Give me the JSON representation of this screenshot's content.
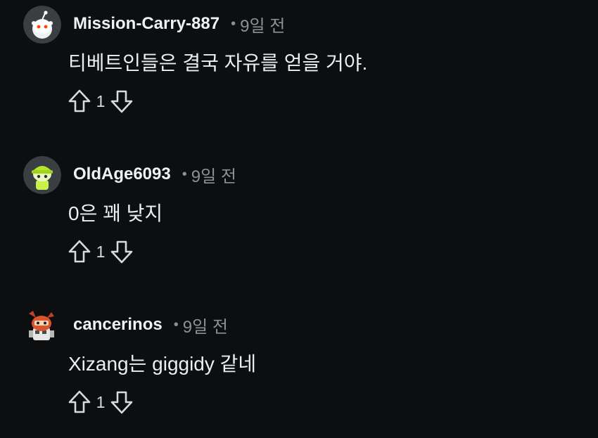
{
  "comments": [
    {
      "username": "Mission-Carry-887",
      "dot": "•",
      "time": "9일 전",
      "text": "티베트인들은 결국 자유를 얻을 거야.",
      "score": "1",
      "avatar": "snoo-default-avatar"
    },
    {
      "username": "OldAge6093",
      "dot": "•",
      "time": "9일 전",
      "text": "0은 꽤 낮지",
      "score": "1",
      "avatar": "snoo-green-avatar"
    },
    {
      "username": "cancerinos",
      "dot": "•",
      "time": "9일 전",
      "text": "Xizang는 giggidy 같네",
      "score": "1",
      "avatar": "snoo-robot-avatar"
    }
  ],
  "icons": {
    "upvote": "upvote-arrow-icon",
    "downvote": "downvote-arrow-icon"
  },
  "colors": {
    "background": "#0c0e10",
    "text": "#eceff1",
    "muted": "#8a9299"
  }
}
